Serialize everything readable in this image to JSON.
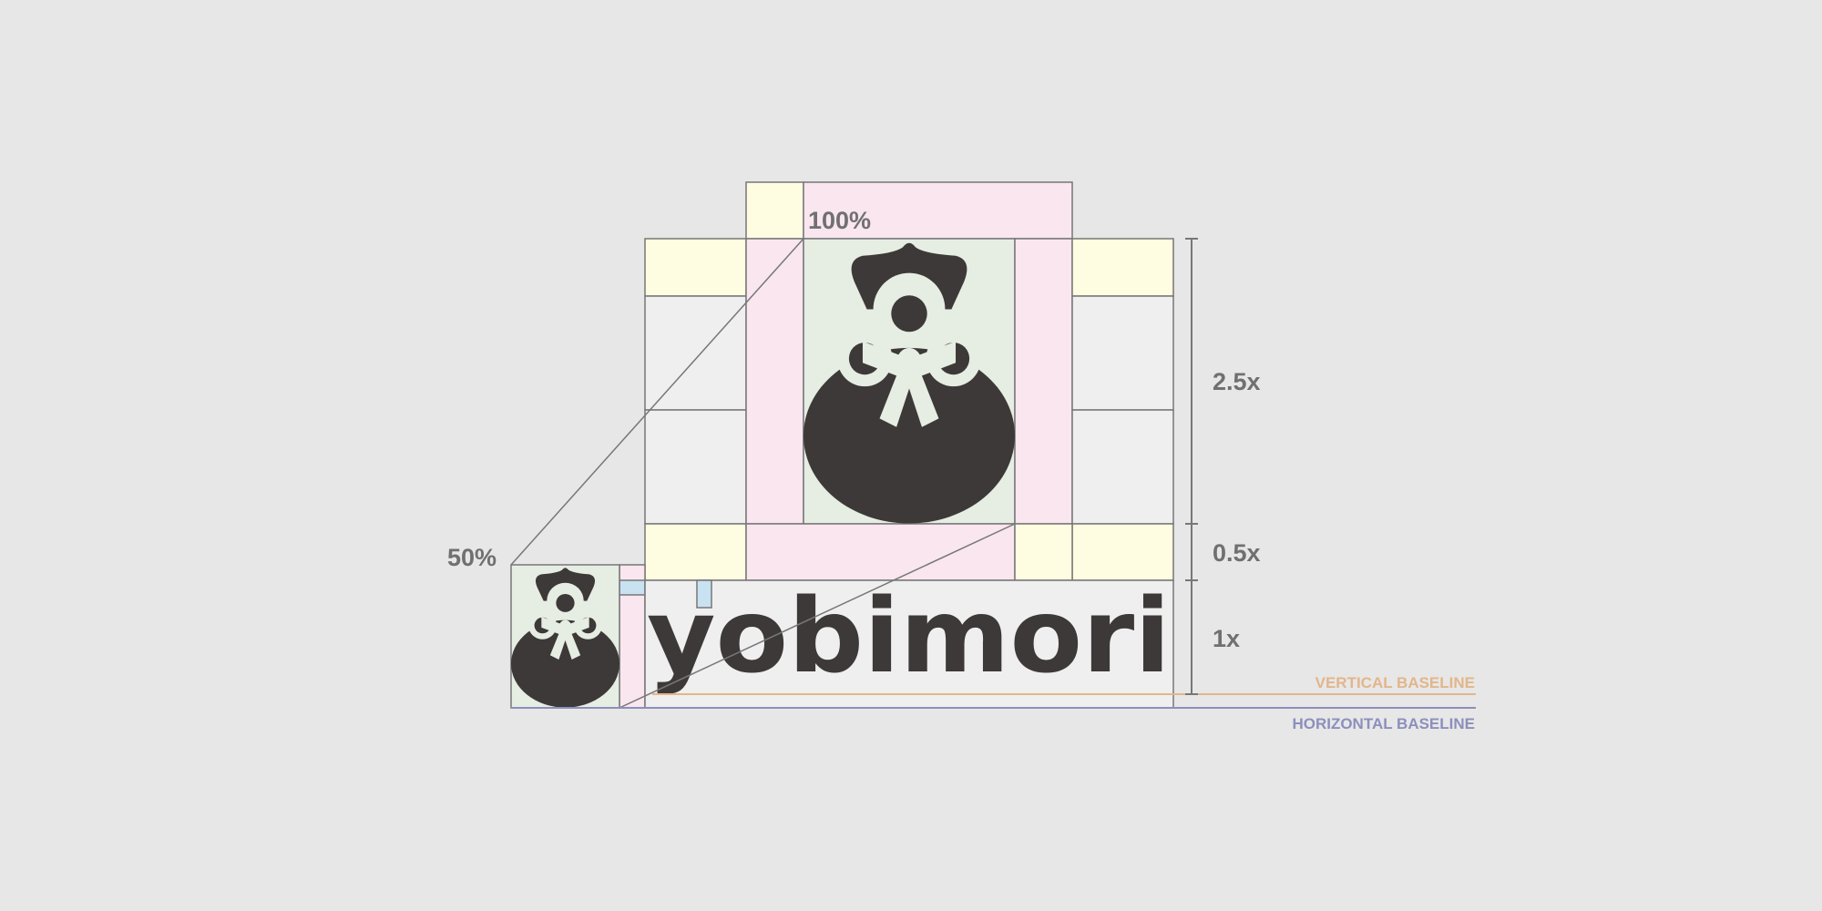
{
  "brand": {
    "wordmark": "yobimori"
  },
  "labels": {
    "scale_full": "100%",
    "scale_half": "50%",
    "ratio_top": "2.5x",
    "ratio_middle": "0.5x",
    "ratio_bottom": "1x",
    "vertical_baseline": "VERTICAL BASELINE",
    "horizontal_baseline": "HORIZONTAL BASELINE"
  },
  "colors": {
    "background": "#e7e7e7",
    "margin_yellow": "#fefde2",
    "margin_pink": "#f9e6ef",
    "icon_area_green": "#e6ede2",
    "grid_gray": "#efefef",
    "spacer_blue": "#c8e2f1",
    "outline": "#777777",
    "ink": "#3d3938",
    "mark_light": "#e6ede2",
    "vertical_baseline": "#e2b68a",
    "horizontal_baseline": "#8c8fbc",
    "label_gray": "#707070"
  },
  "icons": [
    "lucky-bag-icon"
  ]
}
